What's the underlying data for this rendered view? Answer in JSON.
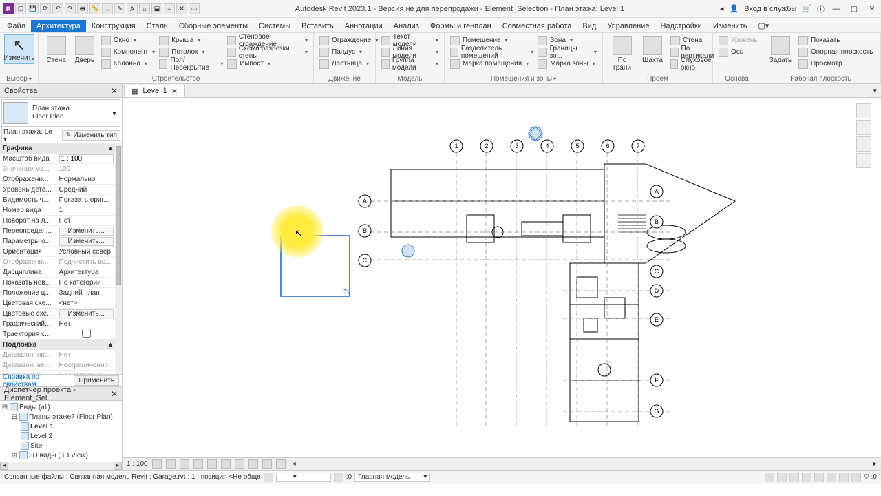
{
  "title": "Autodesk Revit 2023.1 - Версия не для перепродажи - Element_Selection - План этажа: Level 1",
  "title_right": {
    "login": "Вход в службы",
    "help": "?"
  },
  "tabs": [
    "Файл",
    "Архитектура",
    "Конструкция",
    "Сталь",
    "Сборные элементы",
    "Системы",
    "Вставить",
    "Аннотации",
    "Анализ",
    "Формы и генплан",
    "Совместная работа",
    "Вид",
    "Управление",
    "Надстройки",
    "Изменить"
  ],
  "active_tab": 1,
  "ribbon": {
    "select": {
      "btn": "Изменить",
      "title": "Выбор"
    },
    "build": {
      "title": "Строительство",
      "big": [
        {
          "label": "Стена"
        },
        {
          "label": "Дверь"
        }
      ],
      "small": [
        [
          "Окно",
          "Компонент",
          "Колонна"
        ],
        [
          "Крыша",
          "Потолок",
          "Пол/Перекрытие"
        ],
        [
          "Стеновое ограждение",
          "Схема разрезки стены",
          "Импост"
        ]
      ]
    },
    "circ": {
      "title": "Движение",
      "small": [
        "Ограждение",
        "Пандус",
        "Лестница"
      ]
    },
    "model": {
      "title": "Модель",
      "small": [
        "Текст модели",
        "Линия модели",
        "Группа модели"
      ]
    },
    "room": {
      "title": "Помещения и зоны",
      "small1": [
        "Помещение",
        "Разделитель помещений",
        "Марка помещения"
      ],
      "small2": [
        "Зона",
        "Границы зо...",
        "Марка зоны"
      ]
    },
    "opening": {
      "title": "Проем",
      "big": [
        {
          "label": "Стена"
        },
        {
          "label": "По\nграни"
        },
        {
          "label": "Шахта"
        }
      ],
      "small": [
        "Стена",
        "По вертикали",
        "Слуховое окно"
      ]
    },
    "datum": {
      "title": "Основа",
      "small": [
        "Уровень",
        "Ось"
      ]
    },
    "wp": {
      "title": "Рабочая плоскость",
      "big": [
        {
          "label": "Задать"
        }
      ],
      "small": [
        "Показать",
        "Опорная плоскость",
        "Просмотр"
      ]
    }
  },
  "properties": {
    "title": "Свойства",
    "type_title": "План этажа",
    "type_sub": "Floor Plan",
    "selector": "План этажа: Le",
    "edit_type": "Изменить тип",
    "sections": [
      {
        "name": "Графика",
        "rows": [
          {
            "n": "Масштаб вида",
            "v": "1 : 100",
            "input": true
          },
          {
            "n": "Значение ма...",
            "v": "100",
            "dim": true
          },
          {
            "n": "Отображени...",
            "v": "Нормально"
          },
          {
            "n": "Уровень дета...",
            "v": "Средний"
          },
          {
            "n": "Видимость ч...",
            "v": "Показать ориг..."
          },
          {
            "n": "Номер вида",
            "v": "1"
          },
          {
            "n": "Поворот на л...",
            "v": "Нет"
          },
          {
            "n": "Переопредел...",
            "v": "Изменить...",
            "btn": true
          },
          {
            "n": "Параметры о...",
            "v": "Изменить...",
            "btn": true
          },
          {
            "n": "Ориентация",
            "v": "Условный север"
          },
          {
            "n": "Отображени...",
            "v": "Подчистить вс...",
            "dim": true
          },
          {
            "n": "Дисциплина",
            "v": "Архитектура"
          },
          {
            "n": "Показать нев...",
            "v": "По категории"
          },
          {
            "n": "Положение ц...",
            "v": "Задний план"
          },
          {
            "n": "Цветовая схе...",
            "v": "<нет>"
          },
          {
            "n": "Цветовые схе...",
            "v": "Изменить...",
            "btn": true
          },
          {
            "n": "Графический...",
            "v": "Нет"
          },
          {
            "n": "Траектория с...",
            "v": "",
            "check": true
          }
        ]
      },
      {
        "name": "Подложка",
        "rows": [
          {
            "n": "Диапазон: ни...",
            "v": "Нет",
            "dim": true
          },
          {
            "n": "Диапазон: ве...",
            "v": "Неограниченно",
            "dim": true
          },
          {
            "n": "Ориентация ...",
            "v": "Посмотреть в...",
            "dim": true
          }
        ]
      }
    ],
    "footer_link": "Справка по свойствам",
    "footer_apply": "Применить"
  },
  "browser": {
    "title": "Диспетчер проекта - Element_Sel...",
    "nodes": [
      {
        "lvl": 0,
        "t": "Виды (all)",
        "exp": true
      },
      {
        "lvl": 1,
        "t": "Планы этажей (Floor Plan)",
        "exp": true
      },
      {
        "lvl": 2,
        "t": "Level 1",
        "bold": true
      },
      {
        "lvl": 2,
        "t": "Level 2"
      },
      {
        "lvl": 2,
        "t": "Site"
      },
      {
        "lvl": 1,
        "t": "3D виды (3D View)",
        "exp": false
      }
    ]
  },
  "view_tab": {
    "icon": "☰",
    "label": "Level 1"
  },
  "view_controls": {
    "scale": "1 : 100"
  },
  "status": {
    "left": "Связанные файлы : Связанная модель Revit : Garage.rvt : 1 : позиция <Не обще",
    "combo": "Главная модель",
    "filter": ":0"
  },
  "grid": {
    "cols": [
      "1",
      "2",
      "3",
      "4",
      "5",
      "6",
      "7"
    ],
    "rows_left": [
      "A",
      "B",
      "C"
    ],
    "rows_right": [
      "A",
      "B",
      "C",
      "D",
      "E",
      "F",
      "G"
    ]
  }
}
